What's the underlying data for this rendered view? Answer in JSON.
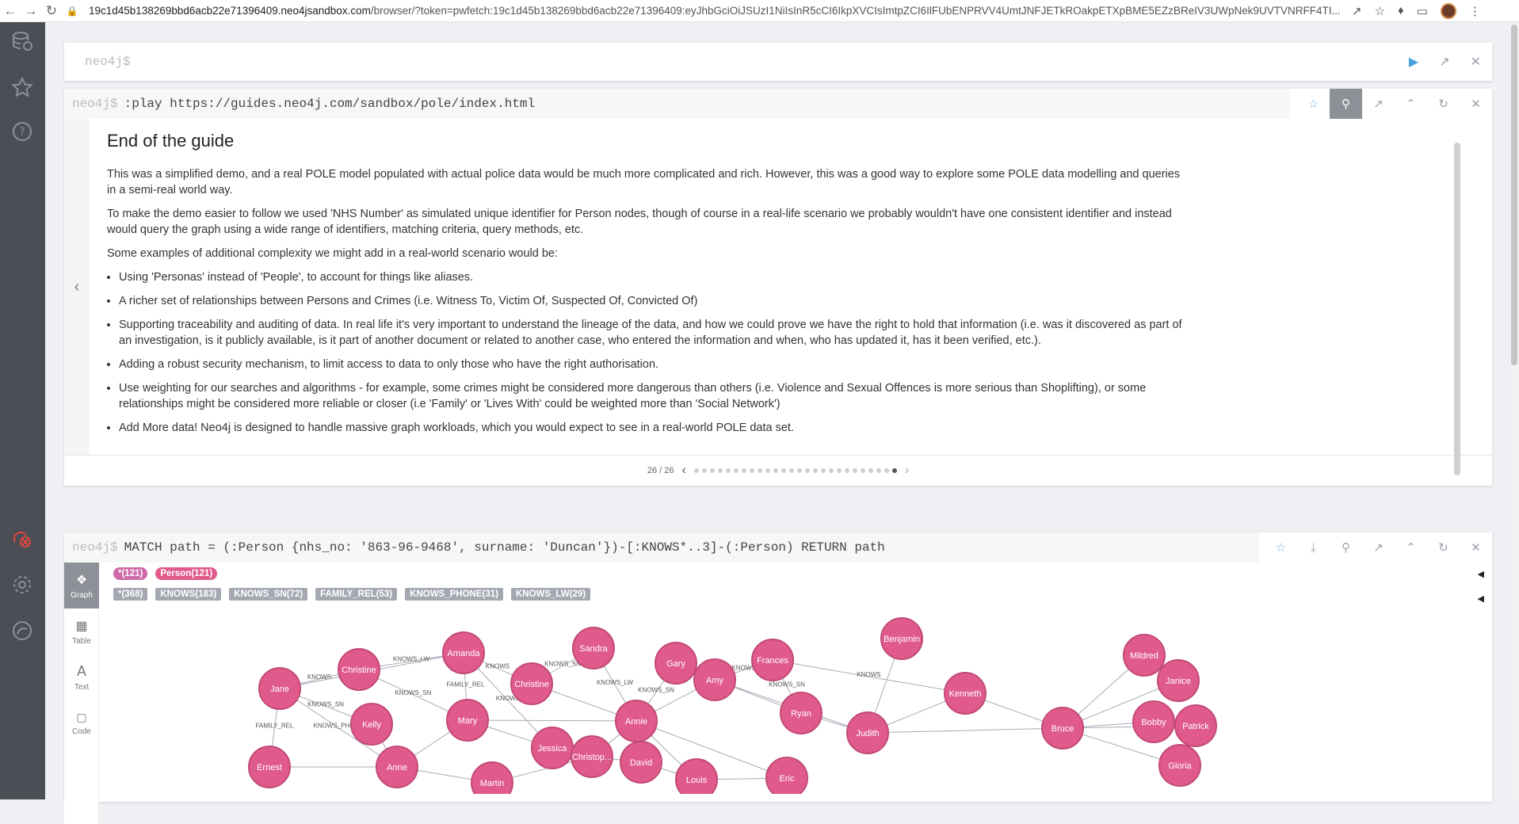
{
  "browser": {
    "url_host": "19c1d45b138269bbd6acb22e71396409.neo4jsandbox.com",
    "url_rest": "/browser/?token=pwfetch:19c1d45b138269bbd6acb22e71396409:eyJhbGciOiJSUzI1NiIsInR5cCI6IkpXVCIsImtpZCI6IlFUbENPRVV4UmtJNFJETkROakpETXpBME5EZzBReIV3UWpNek9UVTVNRFF4TI..."
  },
  "editor": {
    "prompt": "neo4j$"
  },
  "frame1": {
    "prompt": "neo4j$",
    "command": ":play https://guides.neo4j.com/sandbox/pole/index.html"
  },
  "guide": {
    "title": "End of the guide",
    "para1": "This was a simplified demo, and a real POLE model populated with actual police data would be much more complicated and rich. However, this was a good way to explore some POLE data modelling and queries in a semi-real world way.",
    "para2": "To make the demo easier to follow we used 'NHS Number' as simulated unique identifier for Person nodes, though of course in a real-life scenario we probably wouldn't have one consistent identifier and instead would query the graph using a wide range of identifiers, matching criteria, query methods, etc.",
    "para3": "Some examples of additional complexity we might add in a real-world scenario would be:",
    "bullets": [
      "Using 'Personas' instead of 'People', to account for things like aliases.",
      "A richer set of relationships between Persons and Crimes (i.e. Witness To, Victim Of, Suspected Of, Convicted Of)",
      "Supporting traceability and auditing of data. In real life it's very important to understand the lineage of the data, and how we could prove we have the right to hold that information (i.e. was it discovered as part of an investigation, is it publicly available, is it part of another document or related to another case, who entered the information and when, who has updated it, has it been verified, etc.).",
      "Adding a robust security mechanism, to limit access to data to only those who have the right authorisation.",
      "Use weighting for our searches and algorithms - for example, some crimes might be considered more dangerous than others (i.e. Violence and Sexual Offences is more serious than Shoplifting), or some relationships might be considered more reliable or closer (i.e 'Family' or 'Lives With' could be weighted more than 'Social Network')",
      "Add More data! Neo4j is designed to handle massive graph workloads, which you would expect to see in a real-world POLE data set."
    ],
    "page": "26 / 26",
    "total_slides": 26,
    "current_slide": 26
  },
  "frame2": {
    "prompt": "neo4j$",
    "command": "MATCH path = (:Person {nhs_no: '863-96-9468', surname: 'Duncan'})-[:KNOWS*..3]-(:Person) RETURN path"
  },
  "tools": {
    "graph": "Graph",
    "table": "Table",
    "text": "Text",
    "code": "Code"
  },
  "legend": {
    "labels": [
      "*(121)",
      "Person(121)"
    ],
    "rels": [
      "*(368)",
      "KNOWS(183)",
      "KNOWS_SN(72)",
      "FAMILY_REL(53)",
      "KNOWS_PHONE(31)",
      "KNOWS_LW(29)"
    ]
  },
  "graph": {
    "node_color": "#e05b8c",
    "nodes": [
      {
        "name": "Jane"
      },
      {
        "name": "Christine"
      },
      {
        "name": "Amanda"
      },
      {
        "name": "Sandra"
      },
      {
        "name": "Gary"
      },
      {
        "name": "Frances"
      },
      {
        "name": "Benjamin"
      },
      {
        "name": "Mildred"
      },
      {
        "name": "Janice"
      },
      {
        "name": "Kenneth"
      },
      {
        "name": "Christine"
      },
      {
        "name": "Amy"
      },
      {
        "name": "Kelly"
      },
      {
        "name": "Mary"
      },
      {
        "name": "Annie"
      },
      {
        "name": "Ryan"
      },
      {
        "name": "Judith"
      },
      {
        "name": "Bruce"
      },
      {
        "name": "Bobby"
      },
      {
        "name": "Patrick"
      },
      {
        "name": "Jessica"
      },
      {
        "name": "Christop..."
      },
      {
        "name": "David"
      },
      {
        "name": "Ernest"
      },
      {
        "name": "Anne"
      },
      {
        "name": "Louis"
      },
      {
        "name": "Eric"
      },
      {
        "name": "Gloria"
      },
      {
        "name": "Martin"
      }
    ],
    "edge_labels": [
      "KNOWS",
      "KNOWS_SN",
      "FAMILY_REL",
      "KNOWS_PHONE",
      "KNOWS_LW",
      "KNOWS_SN",
      "KNOWS",
      "FAMILY_REL",
      "KNOWS",
      "KNOWS_SN",
      "KNOWS_LW",
      "KNOWS_PHONE",
      "KNOWS_SN",
      "KNOWS",
      "KNOWS_SN",
      "KNOWS"
    ]
  }
}
